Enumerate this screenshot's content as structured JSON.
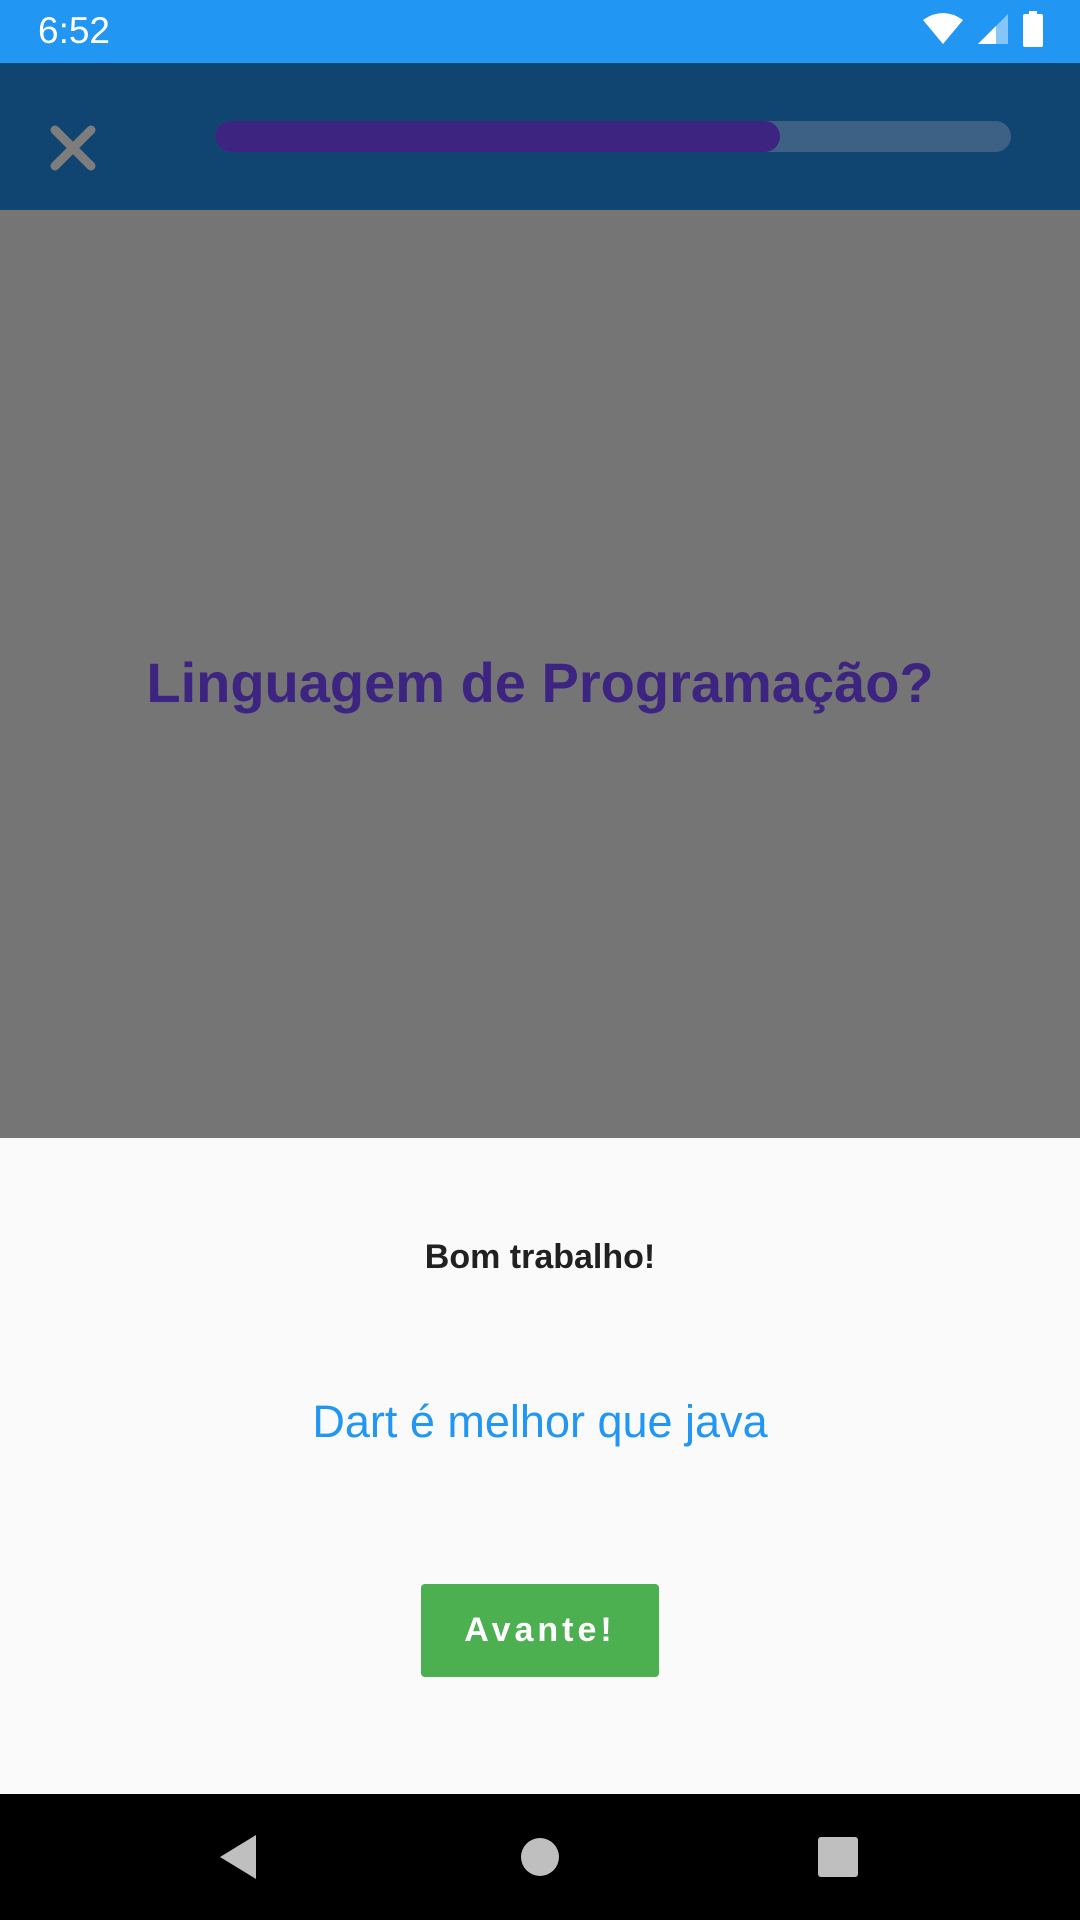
{
  "status_bar": {
    "time": "6:52",
    "icons": [
      "wifi-icon",
      "cellular-signal-icon",
      "battery-icon"
    ],
    "background": "#2196f3"
  },
  "app_bar": {
    "close_icon": "close-icon",
    "progress": 0.71,
    "background": "#0f4570",
    "progress_fill_color": "#3d2480"
  },
  "quiz": {
    "question": "Linguagem de Programação?",
    "question_color": "#3d2480"
  },
  "result_sheet": {
    "title": "Bom trabalho!",
    "message": "Dart é melhor que java",
    "button_label": "Avante!",
    "button_color": "#4caf50",
    "message_color": "#2196f3"
  },
  "nav_bar": {
    "buttons": [
      "back-icon",
      "home-icon",
      "recents-icon"
    ]
  }
}
